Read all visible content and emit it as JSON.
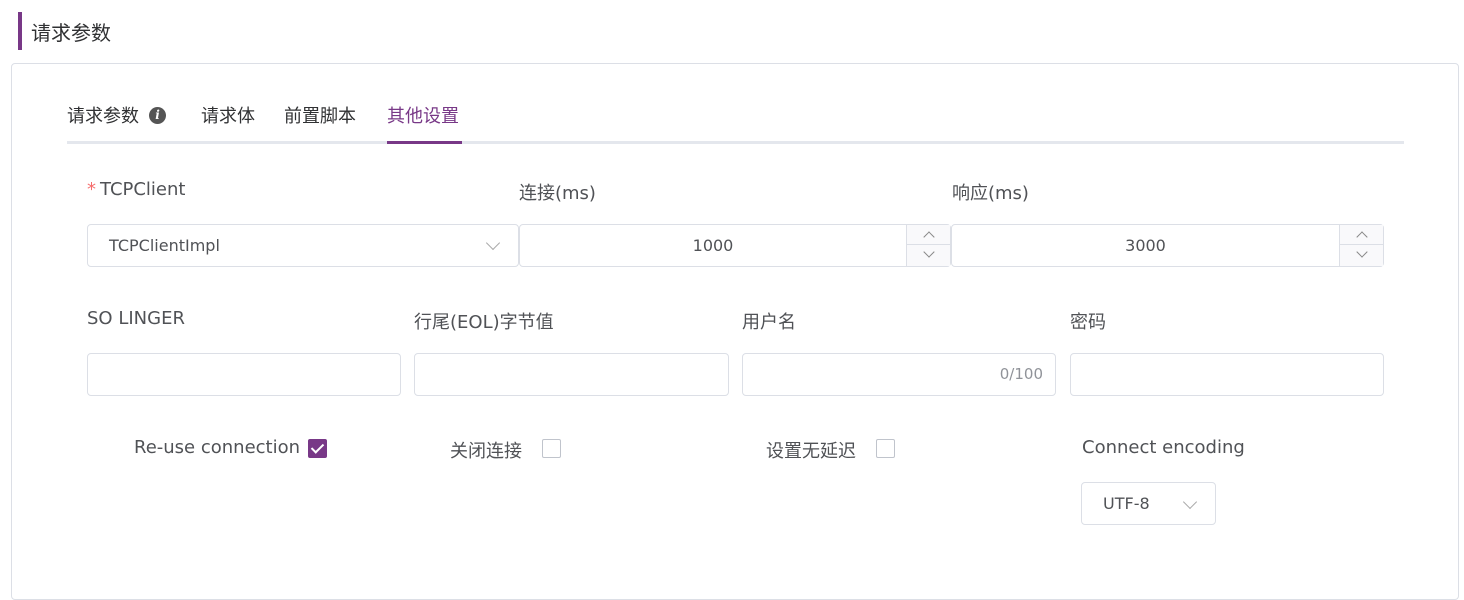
{
  "section": {
    "title": "请求参数"
  },
  "tabs": [
    {
      "label": "请求参数",
      "has_info_icon": true
    },
    {
      "label": "请求体"
    },
    {
      "label": "前置脚本"
    },
    {
      "label": "其他设置",
      "active": true
    }
  ],
  "tcp_client": {
    "label": "TCPClient",
    "required_mark": "*",
    "value": "TCPClientImpl"
  },
  "connect_timeout": {
    "label": "连接(ms)",
    "value": "1000"
  },
  "response_timeout": {
    "label": "响应(ms)",
    "value": "3000"
  },
  "so_linger": {
    "label": "SO LINGER",
    "value": ""
  },
  "eol_byte": {
    "label": "行尾(EOL)字节值",
    "value": ""
  },
  "username": {
    "label": "用户名",
    "value": "",
    "counter": "0/100"
  },
  "password": {
    "label": "密码",
    "value": ""
  },
  "reuse_connection": {
    "label": "Re-use connection",
    "checked": true
  },
  "close_connection": {
    "label": "关闭连接",
    "checked": false
  },
  "no_delay": {
    "label": "设置无延迟",
    "checked": false
  },
  "connect_encoding": {
    "label": "Connect encoding",
    "value": "UTF-8"
  },
  "colors": {
    "accent": "#783887",
    "required": "#f56c6c",
    "border": "#dcdfe6"
  },
  "icons": [
    "info-icon",
    "chevron-down-icon",
    "chevron-up-icon",
    "checkmark-icon"
  ]
}
